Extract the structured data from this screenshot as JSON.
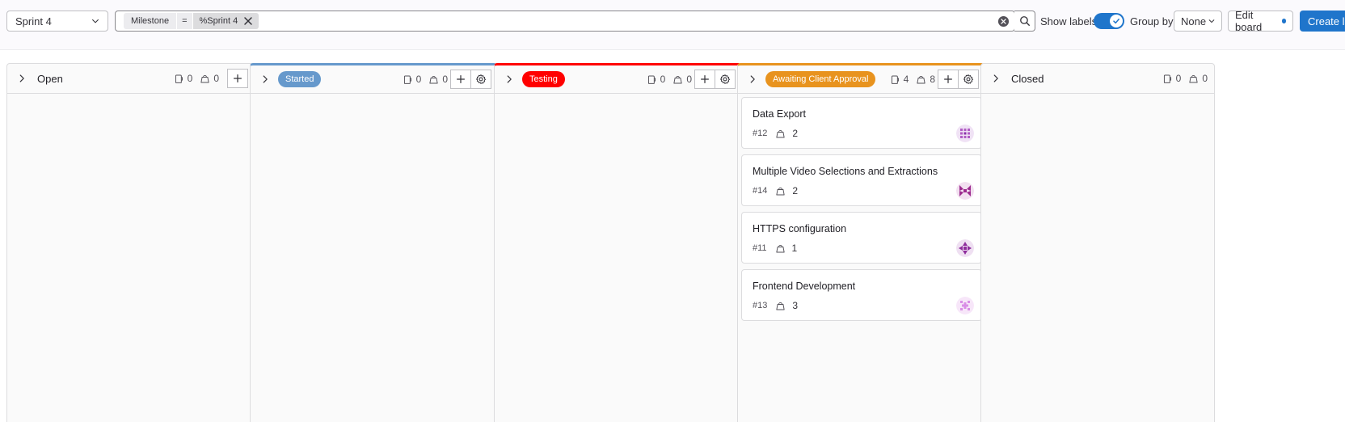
{
  "toolbar": {
    "board_name": "Sprint 4",
    "filter": {
      "field": "Milestone",
      "operator": "=",
      "value": "%Sprint 4"
    },
    "show_labels": "Show labels",
    "show_labels_enabled": true,
    "group_by_label": "Group by",
    "group_by_value": "None",
    "edit_board": "Edit board",
    "create_list": "Create list"
  },
  "colors": {
    "accent": "#1f75cb",
    "started": "#6699cc",
    "testing": "#ff0000",
    "awaiting": "#e8931e"
  },
  "columns": [
    {
      "title": "Open",
      "issue_count": "0",
      "weight": "0"
    },
    {
      "title": "Started",
      "issue_count": "0",
      "weight": "0",
      "color": "#6699cc"
    },
    {
      "title": "Testing",
      "issue_count": "0",
      "weight": "0",
      "color": "#ff0000"
    },
    {
      "title": "Awaiting Client Approval",
      "issue_count": "4",
      "weight": "8",
      "color": "#e8931e",
      "cards": [
        {
          "title": "Data Export",
          "ref": "#12",
          "weight": "2"
        },
        {
          "title": "Multiple Video Selections and Extractions",
          "ref": "#14",
          "weight": "2"
        },
        {
          "title": "HTTPS configuration",
          "ref": "#11",
          "weight": "1"
        },
        {
          "title": "Frontend Development",
          "ref": "#13",
          "weight": "3"
        }
      ]
    },
    {
      "title": "Closed",
      "issue_count": "0",
      "weight": "0"
    }
  ]
}
